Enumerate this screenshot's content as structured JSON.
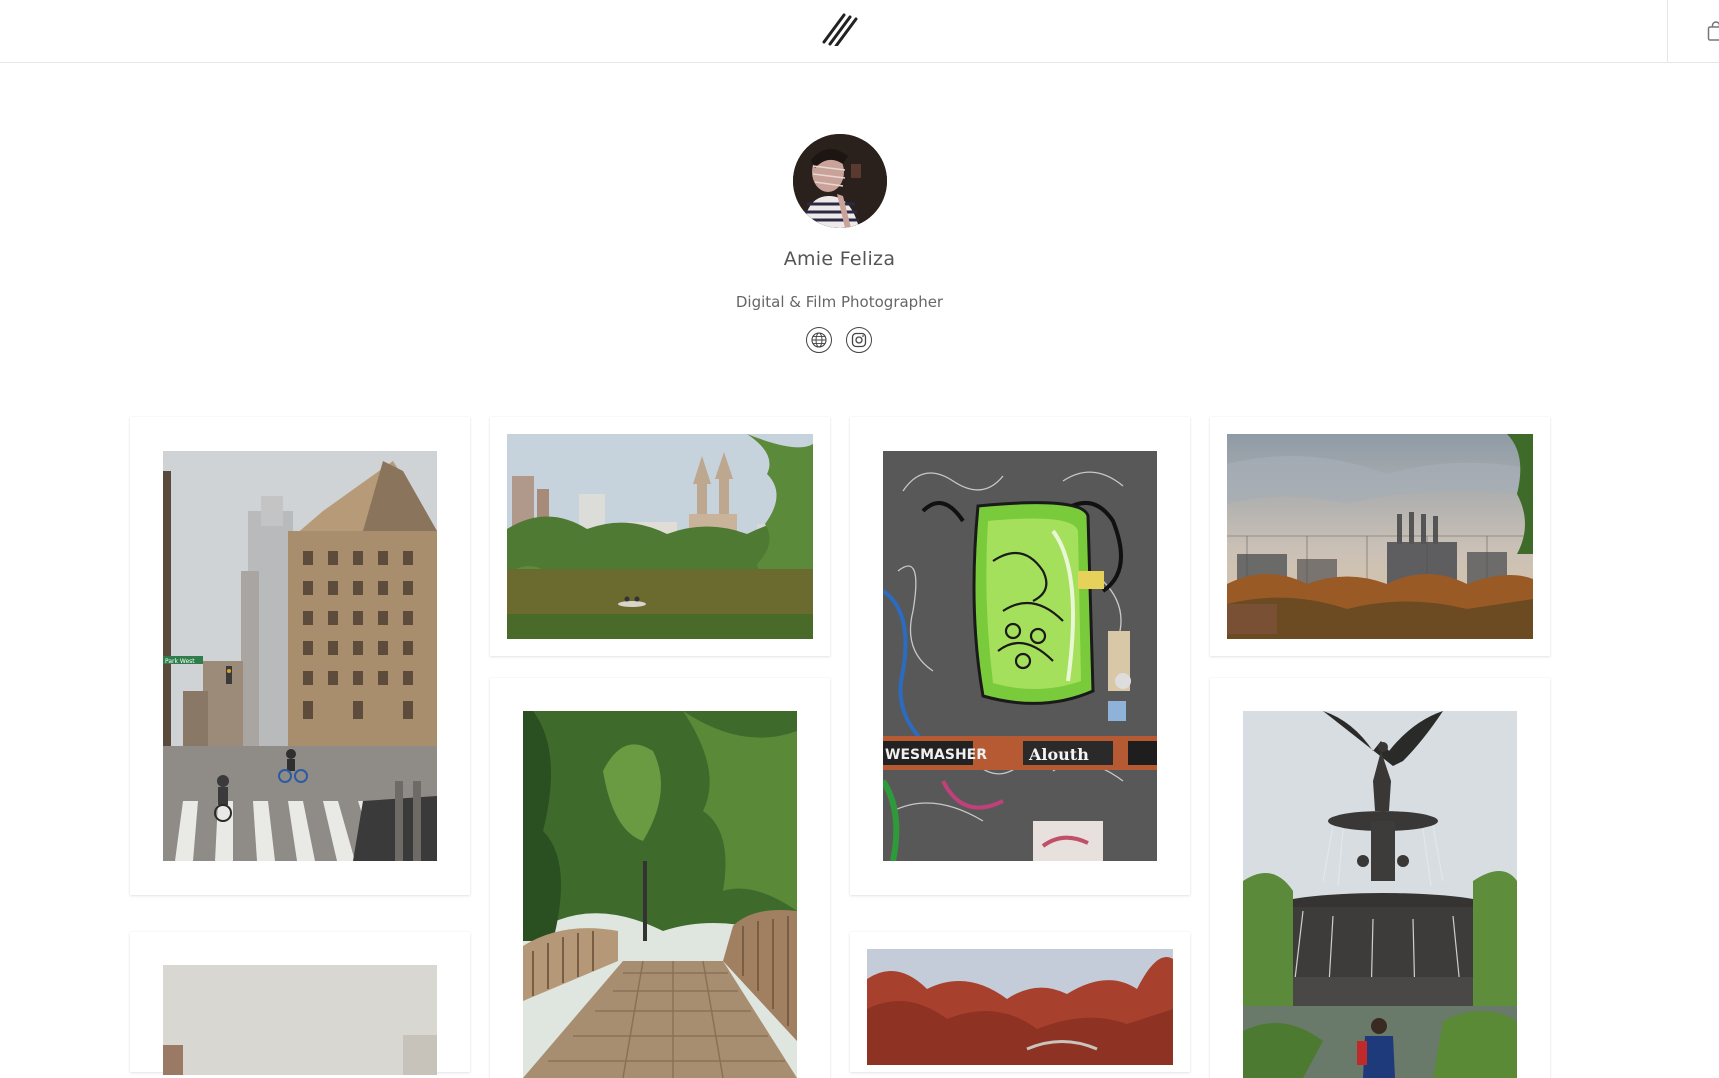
{
  "header": {
    "logo_icon": "double-slash-logo-icon",
    "cart_icon": "shopping-bag-icon"
  },
  "profile": {
    "name": "Amie Feliza",
    "tagline": "Digital & Film Photographer",
    "avatar_icon": "profile-avatar",
    "links": [
      {
        "icon": "globe-icon"
      },
      {
        "icon": "instagram-icon"
      }
    ]
  },
  "gallery": {
    "photos": [
      {
        "subject": "dakota-building-street"
      },
      {
        "subject": "central-park-lake-rowboat"
      },
      {
        "subject": "graffiti-door"
      },
      {
        "subject": "industrial-skyline-fence"
      },
      {
        "subject": "wooden-bridge-park"
      },
      {
        "subject": "bethesda-fountain-angel"
      },
      {
        "subject": "building-partial"
      },
      {
        "subject": "red-foliage-bridge"
      }
    ],
    "sign_text": {
      "street_sign": "Park West",
      "graffiti_left": "WESMASHER",
      "graffiti_right": "Alouth"
    }
  },
  "colors": {
    "border": "#e6e6e6",
    "text": "#555555",
    "sky": "#c9d3dc"
  }
}
